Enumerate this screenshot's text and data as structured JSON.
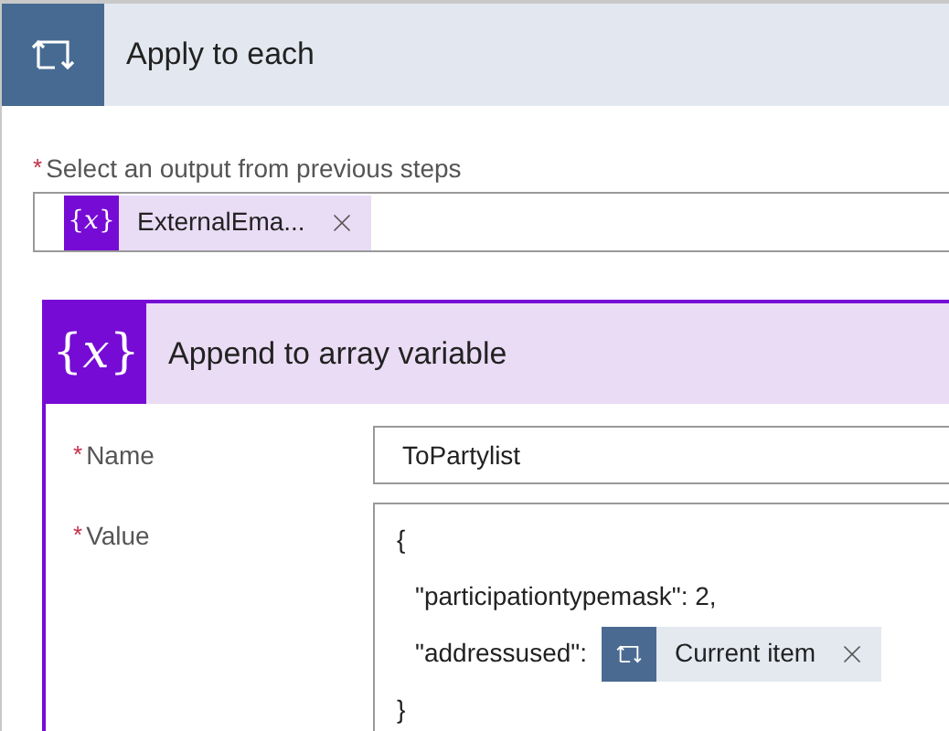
{
  "loop": {
    "title": "Apply to each",
    "output_field": {
      "required_mark": "*",
      "label": "Select an output from previous steps",
      "token": {
        "kind": "variable",
        "icon_text": "{*x*}",
        "label": "ExternalEma..."
      }
    }
  },
  "action": {
    "icon_text": "{*x*}",
    "title": "Append to array variable",
    "fields": [
      {
        "kind": "input",
        "required_mark": "*",
        "label": "Name",
        "value": "ToPartylist"
      },
      {
        "kind": "code",
        "required_mark": "*",
        "label": "Value",
        "lines": [
          {
            "text": "{"
          },
          {
            "text": "\"participationtypemask\": 2,"
          },
          {
            "text": "\"addressused\":",
            "token": {
              "kind": "loop",
              "label": "Current item"
            }
          },
          {
            "text": "}"
          }
        ]
      }
    ]
  }
}
